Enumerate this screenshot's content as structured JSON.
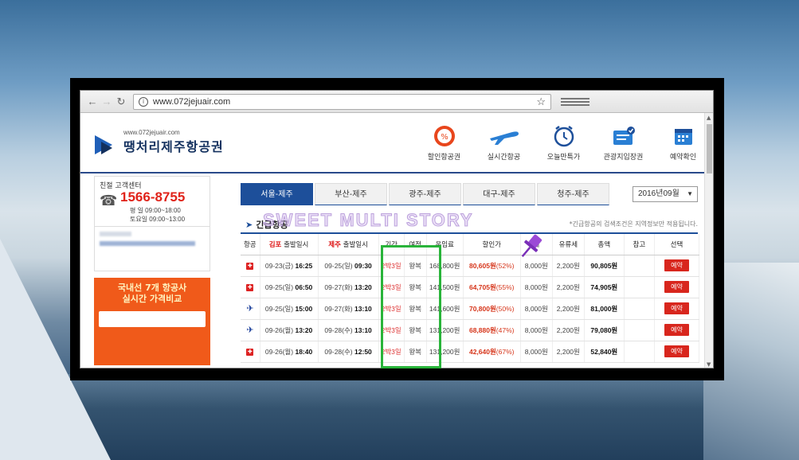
{
  "browser": {
    "url": "www.072jejuair.com"
  },
  "site": {
    "logo_small": "www.072jejuair.com",
    "logo_name": "땡처리제주항공권",
    "nav": [
      {
        "label": "할인항공권",
        "icon": "discount-badge-icon"
      },
      {
        "label": "실시간항공",
        "icon": "airplane-icon"
      },
      {
        "label": "오늘만특가",
        "icon": "alarm-clock-icon"
      },
      {
        "label": "관광지입장권",
        "icon": "ticket-check-icon"
      },
      {
        "label": "예약확인",
        "icon": "calendar-check-icon"
      }
    ]
  },
  "sidebar": {
    "cs_title": "친절 고객센터",
    "phone": "1566-8755",
    "hours_weekday": "평   일  09:00~18:00",
    "hours_saturday": "토요일  09:00~13:00",
    "ad_line1": "국내선 7개 항공사",
    "ad_line2": "실시간 가격비교"
  },
  "tabs": [
    "서울-제주",
    "부산-제주",
    "광주-제주",
    "대구-제주",
    "청주-제주"
  ],
  "month_select": "2016년09월",
  "section": {
    "title": "긴급항공",
    "note": "*긴급항공의 검색조건은 지역정보만 적용됩니다.",
    "watermark": "SWEET MULTI STORY"
  },
  "table": {
    "headers": {
      "airline": "항공",
      "dep_city": "김포",
      "dep_label": "출발일시",
      "arr_city": "제주",
      "arr_label": "출발일시",
      "duration": "기간",
      "trip": "여정",
      "fare": "운임료",
      "discount": "할인가",
      "tax": "세",
      "fuel": "유류세",
      "total": "총액",
      "note": "참고",
      "select": "선택"
    },
    "rows": [
      {
        "airline_icon": "red-airline-icon",
        "dep_date": "09-23(금)",
        "dep_time": "16:25",
        "arr_date": "09-25(일)",
        "arr_time": "09:30",
        "duration": "2박3일",
        "trip": "왕복",
        "fare": "168,800원",
        "discount": "80,605원",
        "discount_pct": "(52%)",
        "tax": "8,000원",
        "fuel": "2,200원",
        "total": "90,805원",
        "reserve": "예약"
      },
      {
        "airline_icon": "red-airline-icon",
        "dep_date": "09-25(일)",
        "dep_time": "06:50",
        "arr_date": "09-27(화)",
        "arr_time": "13:20",
        "duration": "2박3일",
        "trip": "왕복",
        "fare": "141,500원",
        "discount": "64,705원",
        "discount_pct": "(55%)",
        "tax": "8,000원",
        "fuel": "2,200원",
        "total": "74,905원",
        "reserve": "예약"
      },
      {
        "airline_icon": "blue-airline-icon",
        "dep_date": "09-25(일)",
        "dep_time": "15:00",
        "arr_date": "09-27(화)",
        "arr_time": "13:10",
        "duration": "2박3일",
        "trip": "왕복",
        "fare": "141,600원",
        "discount": "70,800원",
        "discount_pct": "(50%)",
        "tax": "8,000원",
        "fuel": "2,200원",
        "total": "81,000원",
        "reserve": "예약"
      },
      {
        "airline_icon": "blue-airline-icon",
        "dep_date": "09-26(월)",
        "dep_time": "13:20",
        "arr_date": "09-28(수)",
        "arr_time": "13:10",
        "duration": "2박3일",
        "trip": "왕복",
        "fare": "131,200원",
        "discount": "68,880원",
        "discount_pct": "(47%)",
        "tax": "8,000원",
        "fuel": "2,200원",
        "total": "79,080원",
        "reserve": "예약"
      },
      {
        "airline_icon": "red-airline-icon",
        "dep_date": "09-26(월)",
        "dep_time": "18:40",
        "arr_date": "09-28(수)",
        "arr_time": "12:50",
        "duration": "2박3일",
        "trip": "왕복",
        "fare": "131,200원",
        "discount": "42,640원",
        "discount_pct": "(67%)",
        "tax": "8,000원",
        "fuel": "2,200원",
        "total": "52,840원",
        "reserve": "예약"
      }
    ]
  },
  "colors": {
    "brand_navy": "#1d4f9a",
    "accent_red": "#d8261d",
    "highlight_green": "#29b43a"
  }
}
